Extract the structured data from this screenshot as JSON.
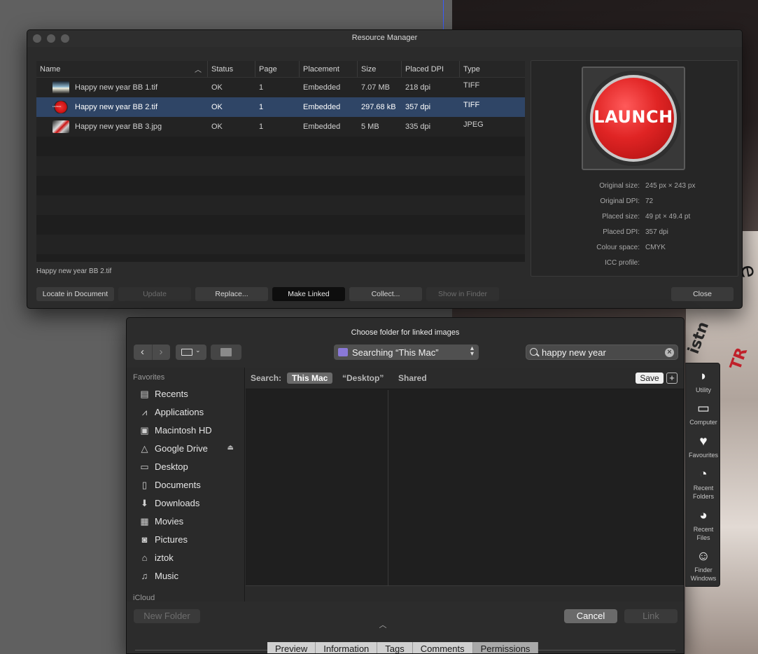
{
  "resource_manager": {
    "title": "Resource Manager",
    "columns": [
      "Name",
      "Status",
      "Page",
      "Placement",
      "Size",
      "Placed DPI",
      "Type"
    ],
    "rows": [
      {
        "name": "Happy new year BB 1.tif",
        "status": "OK",
        "page": "1",
        "placement": "Embedded",
        "size": "7.07 MB",
        "dpi": "218 dpi",
        "type": "TIFF"
      },
      {
        "name": "Happy new year BB 2.tif",
        "status": "OK",
        "page": "1",
        "placement": "Embedded",
        "size": "297.68 kB",
        "dpi": "357 dpi",
        "type": "TIFF"
      },
      {
        "name": "Happy new year BB 3.jpg",
        "status": "OK",
        "page": "1",
        "placement": "Embedded",
        "size": "5 MB",
        "dpi": "335 dpi",
        "type": "JPEG"
      }
    ],
    "selected_name": "Happy new year BB 2.tif",
    "preview_text": "LAUNCH",
    "thumb_text": "LAUNCH",
    "info": [
      {
        "label": "Original size:",
        "value": "245 px × 243 px"
      },
      {
        "label": "Original DPI:",
        "value": "72"
      },
      {
        "label": "Placed size:",
        "value": "49 pt × 49.4 pt"
      },
      {
        "label": "Placed DPI:",
        "value": "357 dpi"
      },
      {
        "label": "Colour space:",
        "value": "CMYK"
      },
      {
        "label": "ICC profile:",
        "value": ""
      }
    ],
    "buttons": {
      "locate": "Locate in Document",
      "update": "Update",
      "replace": "Replace...",
      "make_linked": "Make Linked",
      "collect": "Collect...",
      "show_in_finder": "Show in Finder",
      "close": "Close"
    }
  },
  "choose_folder": {
    "title": "Choose folder for linked images",
    "location": "Searching “This Mac”",
    "search_value": "happy new year",
    "favorites_header": "Favorites",
    "sidebar": [
      "Recents",
      "Applications",
      "Macintosh HD",
      "Google Drive",
      "Desktop",
      "Documents",
      "Downloads",
      "Movies",
      "Pictures",
      "iztok",
      "Music"
    ],
    "icloud_header": "iCloud",
    "scope_label": "Search:",
    "scopes": [
      "This Mac",
      "“Desktop”",
      "Shared"
    ],
    "save_label": "Save",
    "new_folder": "New Folder",
    "cancel": "Cancel",
    "link": "Link",
    "tabs": [
      "Preview",
      "Information",
      "Tags",
      "Comments",
      "Permissions"
    ]
  },
  "right_toolbar": [
    {
      "label": "Utility",
      "icon": "utility-icon"
    },
    {
      "label": "Computer",
      "icon": "computer-icon"
    },
    {
      "label": "Favourites",
      "icon": "heart-icon"
    },
    {
      "label": "Recent Folders",
      "icon": "recent-folders-icon"
    },
    {
      "label": "Recent Files",
      "icon": "recent-files-icon"
    },
    {
      "label": "Finder Windows",
      "icon": "finder-icon"
    }
  ]
}
